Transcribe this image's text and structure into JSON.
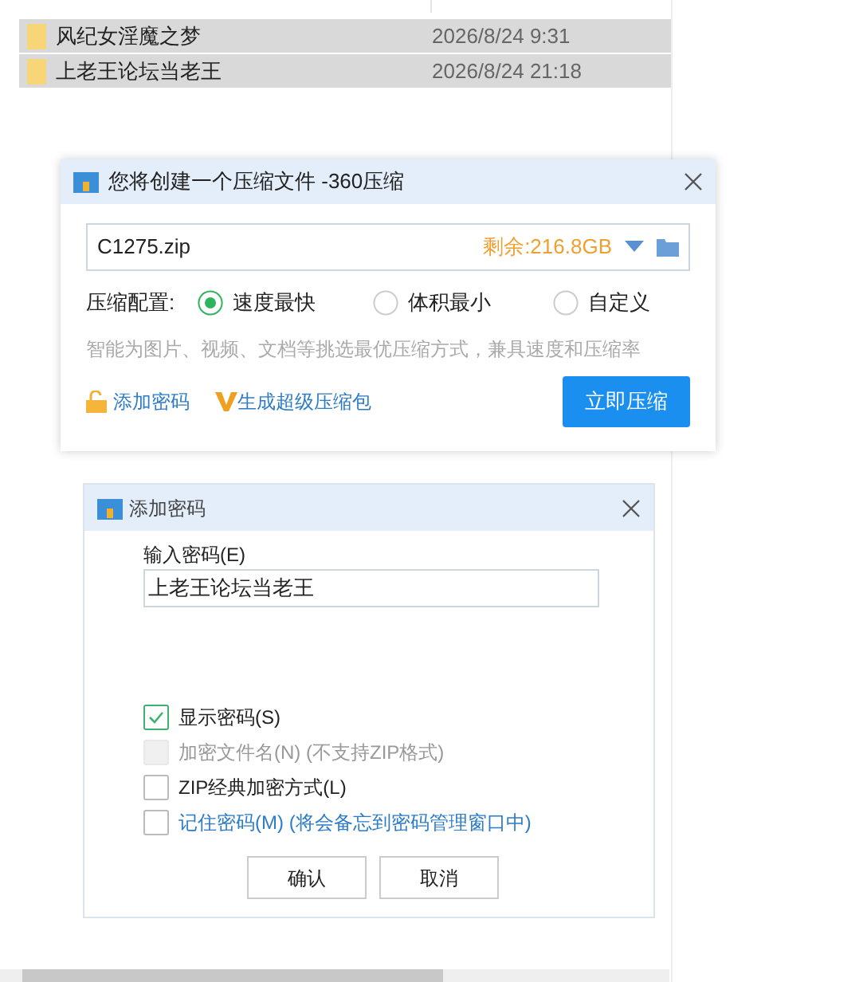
{
  "file_list": {
    "rows": [
      {
        "name": "风纪女淫魔之梦",
        "modified": "2026/8/24 9:31",
        "selected": true
      },
      {
        "name": "上老王论坛当老王",
        "modified": "2026/8/24 21:18",
        "selected": true
      }
    ]
  },
  "compress_dialog": {
    "title": "您将创建一个压缩文件 -360压缩",
    "file_name": "C1275.zip",
    "free_space": "剩余:216.8GB",
    "config_label": "压缩配置:",
    "options": [
      {
        "label": "速度最快",
        "selected": true
      },
      {
        "label": "体积最小",
        "selected": false
      },
      {
        "label": "自定义",
        "selected": false
      }
    ],
    "hint": "智能为图片、视频、文档等挑选最优压缩方式，兼具速度和压缩率",
    "add_password_link": "添加密码",
    "super_pack_link": "生成超级压缩包",
    "compress_button": "立即压缩"
  },
  "password_dialog": {
    "title": "添加密码",
    "field_label": "输入密码(E)",
    "password_value": "上老王论坛当老王",
    "options": [
      {
        "label": "显示密码(S)",
        "checked": true,
        "disabled": false,
        "kind": "normal"
      },
      {
        "label": "加密文件名(N) (不支持ZIP格式)",
        "checked": false,
        "disabled": true,
        "kind": "normal"
      },
      {
        "label": "ZIP经典加密方式(L)",
        "checked": false,
        "disabled": false,
        "kind": "normal"
      },
      {
        "label": "记住密码(M) (将会备忘到密码管理窗口中)",
        "checked": false,
        "disabled": false,
        "kind": "link"
      }
    ],
    "buttons": [
      "确认",
      "取消"
    ]
  }
}
